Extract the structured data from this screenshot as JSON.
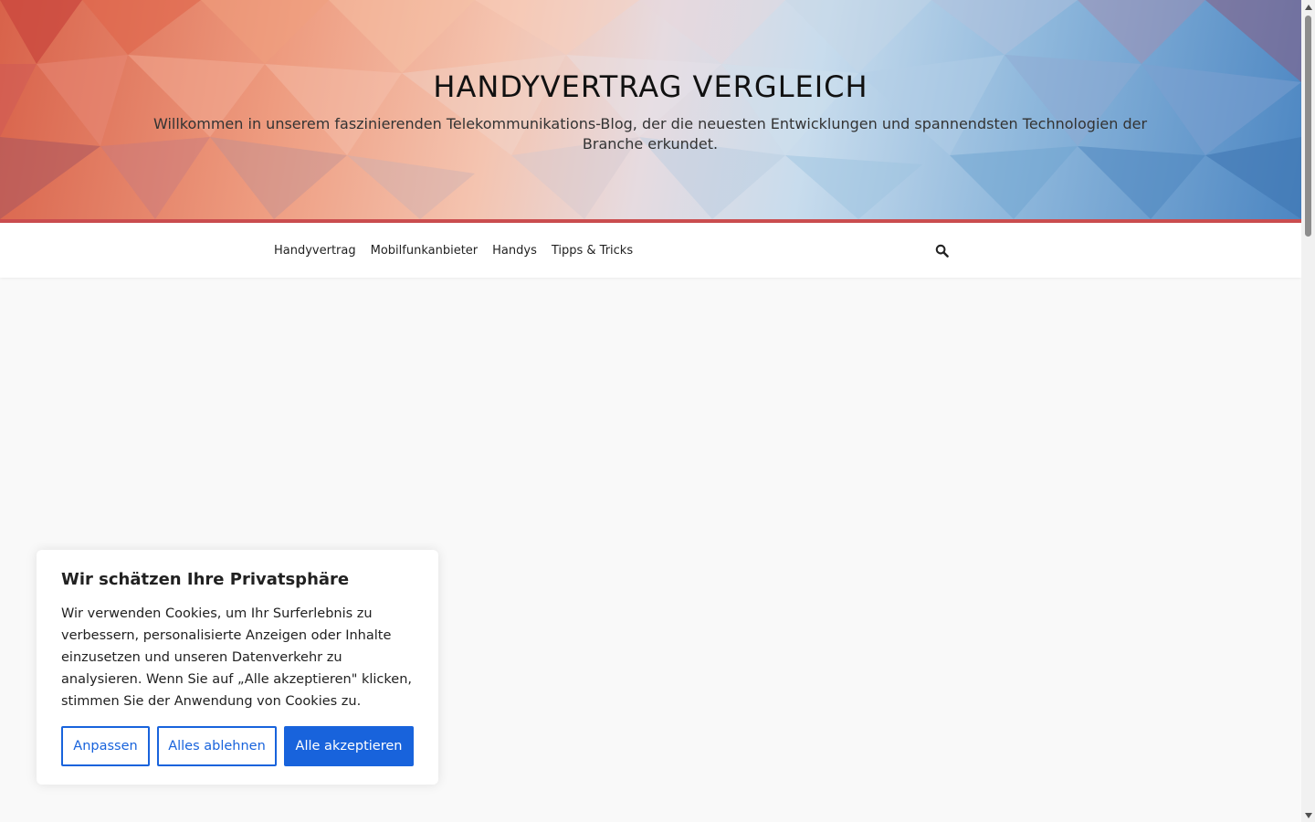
{
  "header": {
    "site_title": "HANDYVERTRAG VERGLEICH",
    "site_description": "Willkommen in unserem faszinierenden Telekommunikations-Blog, der die neuesten Entwicklungen und spannendsten Technologien der Branche erkundet."
  },
  "colors": {
    "accent_line": "#cb4d4f",
    "primary_button": "#1863dc",
    "page_background": "#f9f9f9"
  },
  "nav": {
    "items": [
      {
        "label": "Handyvertrag"
      },
      {
        "label": "Mobilfunkanbieter"
      },
      {
        "label": "Handys"
      },
      {
        "label": "Tipps & Tricks"
      }
    ],
    "search_icon": "search-icon"
  },
  "cookie_banner": {
    "title": "Wir schätzen Ihre Privatsphäre",
    "text": "Wir verwenden Cookies, um Ihr Surferlebnis zu verbessern, personalisierte Anzeigen oder Inhalte einzusetzen und unseren Datenverkehr zu analysieren. Wenn Sie auf „Alle akzeptieren\" klicken, stimmen Sie der Anwendung von Cookies zu.",
    "customize_label": "Anpassen",
    "reject_label": "Alles ablehnen",
    "accept_label": "Alle akzeptieren"
  }
}
